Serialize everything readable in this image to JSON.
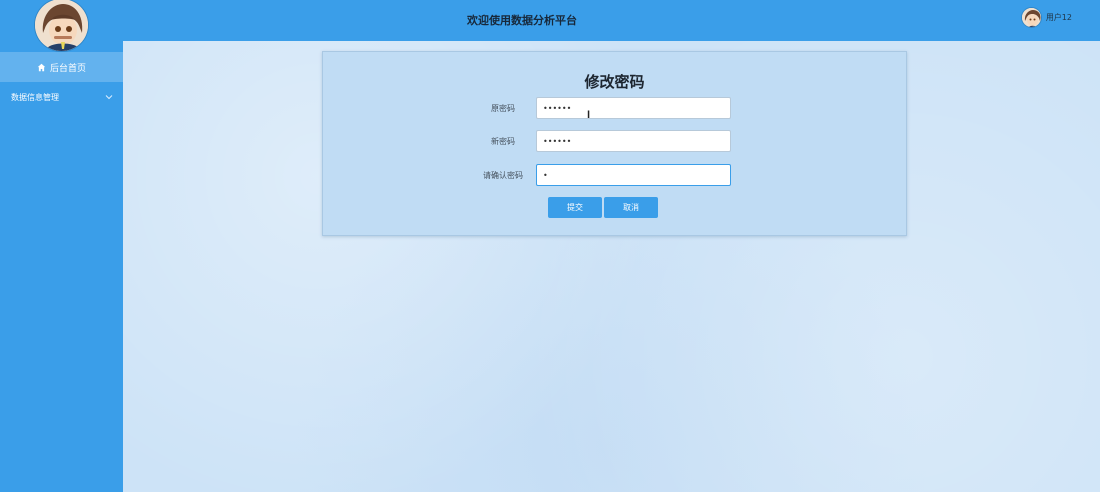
{
  "app": {
    "title": "欢迎使用数据分析平台"
  },
  "user": {
    "name": "用户12"
  },
  "sidebar": {
    "home_label": "后台首页",
    "data_menu_label": "数据信息管理"
  },
  "form": {
    "title": "修改密码",
    "old_password_label": "原密码",
    "old_password_value": "••••••",
    "new_password_label": "新密码",
    "new_password_value": "••••••",
    "confirm_password_label": "请确认密码",
    "confirm_password_value": "•",
    "submit_label": "提交",
    "cancel_label": "取消"
  },
  "icons": {
    "home": "home-icon",
    "chevron": "chevron-down-icon",
    "user_avatar": "avatar",
    "text_cursor": "text-cursor-icon"
  },
  "colors": {
    "primary": "#3a9ee9",
    "sidebar_active": "#63b2ee",
    "content_background": "#cde3f7",
    "card_background": "#c0dcf4"
  }
}
